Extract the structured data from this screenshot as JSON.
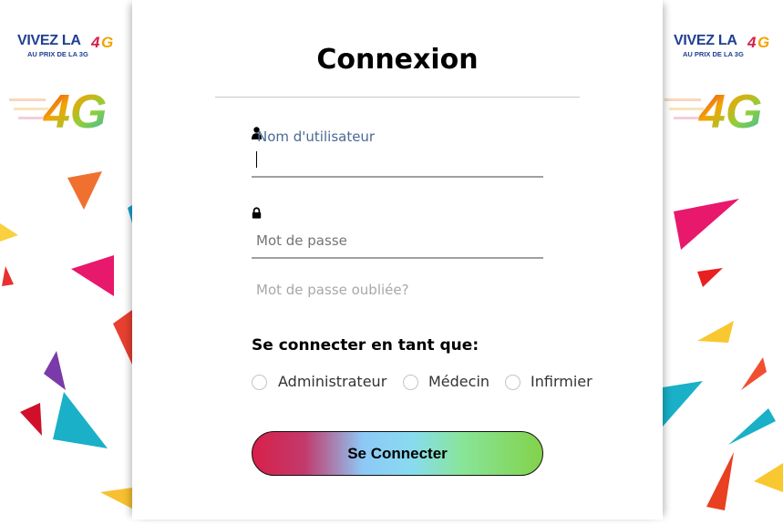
{
  "promo": {
    "headline": "VIVEZ LA",
    "tagline": "AU PRIX DE LA 3G",
    "logo_text": "4G"
  },
  "login": {
    "title": "Connexion",
    "username": {
      "label": "Nom d'utilisateur",
      "value": "",
      "icon": "user-icon"
    },
    "password": {
      "placeholder": "Mot de passe",
      "value": "",
      "icon": "lock-icon"
    },
    "forgot_link": "Mot de passe oubliée?",
    "role_heading": "Se connecter en tant que:",
    "roles": [
      {
        "label": "Administrateur",
        "selected": false
      },
      {
        "label": "Médecin",
        "selected": false
      },
      {
        "label": "Infirmier",
        "selected": false
      }
    ],
    "submit_label": "Se Connecter"
  },
  "colors": {
    "label_blue": "#4a6a94",
    "promo_blue": "#1f3f8f",
    "button_gradient": [
      "#d8204a",
      "#8ec8f6",
      "#82d24a"
    ]
  }
}
